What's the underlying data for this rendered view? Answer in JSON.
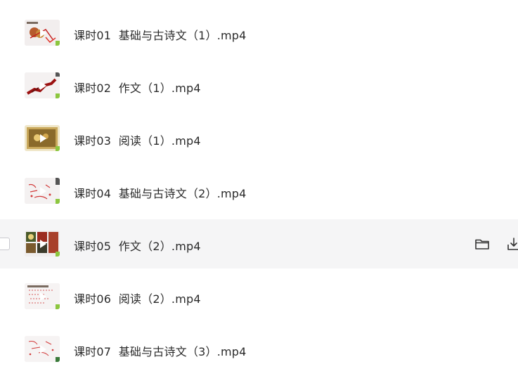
{
  "files": [
    {
      "name": "课时01  基础与古诗文（1）.mp4",
      "thumb_icon": "video-thumbnail"
    },
    {
      "name": "课时02  作文（1）.mp4",
      "thumb_icon": "video-thumbnail"
    },
    {
      "name": "课时03  阅读（1）.mp4",
      "thumb_icon": "video-thumbnail"
    },
    {
      "name": "课时04  基础与古诗文（2）.mp4",
      "thumb_icon": "video-thumbnail"
    },
    {
      "name": "课时05  作文（2）.mp4",
      "thumb_icon": "video-thumbnail",
      "hovered": true
    },
    {
      "name": "课时06  阅读（2）.mp4",
      "thumb_icon": "video-thumbnail"
    },
    {
      "name": "课时07  基础与古诗文（3）.mp4",
      "thumb_icon": "video-thumbnail"
    }
  ],
  "row_actions": [
    "folder-icon",
    "download-icon"
  ],
  "colors": {
    "hover_background": "#f5f5f6",
    "text": "#2a2a2a",
    "icon": "#333333"
  }
}
